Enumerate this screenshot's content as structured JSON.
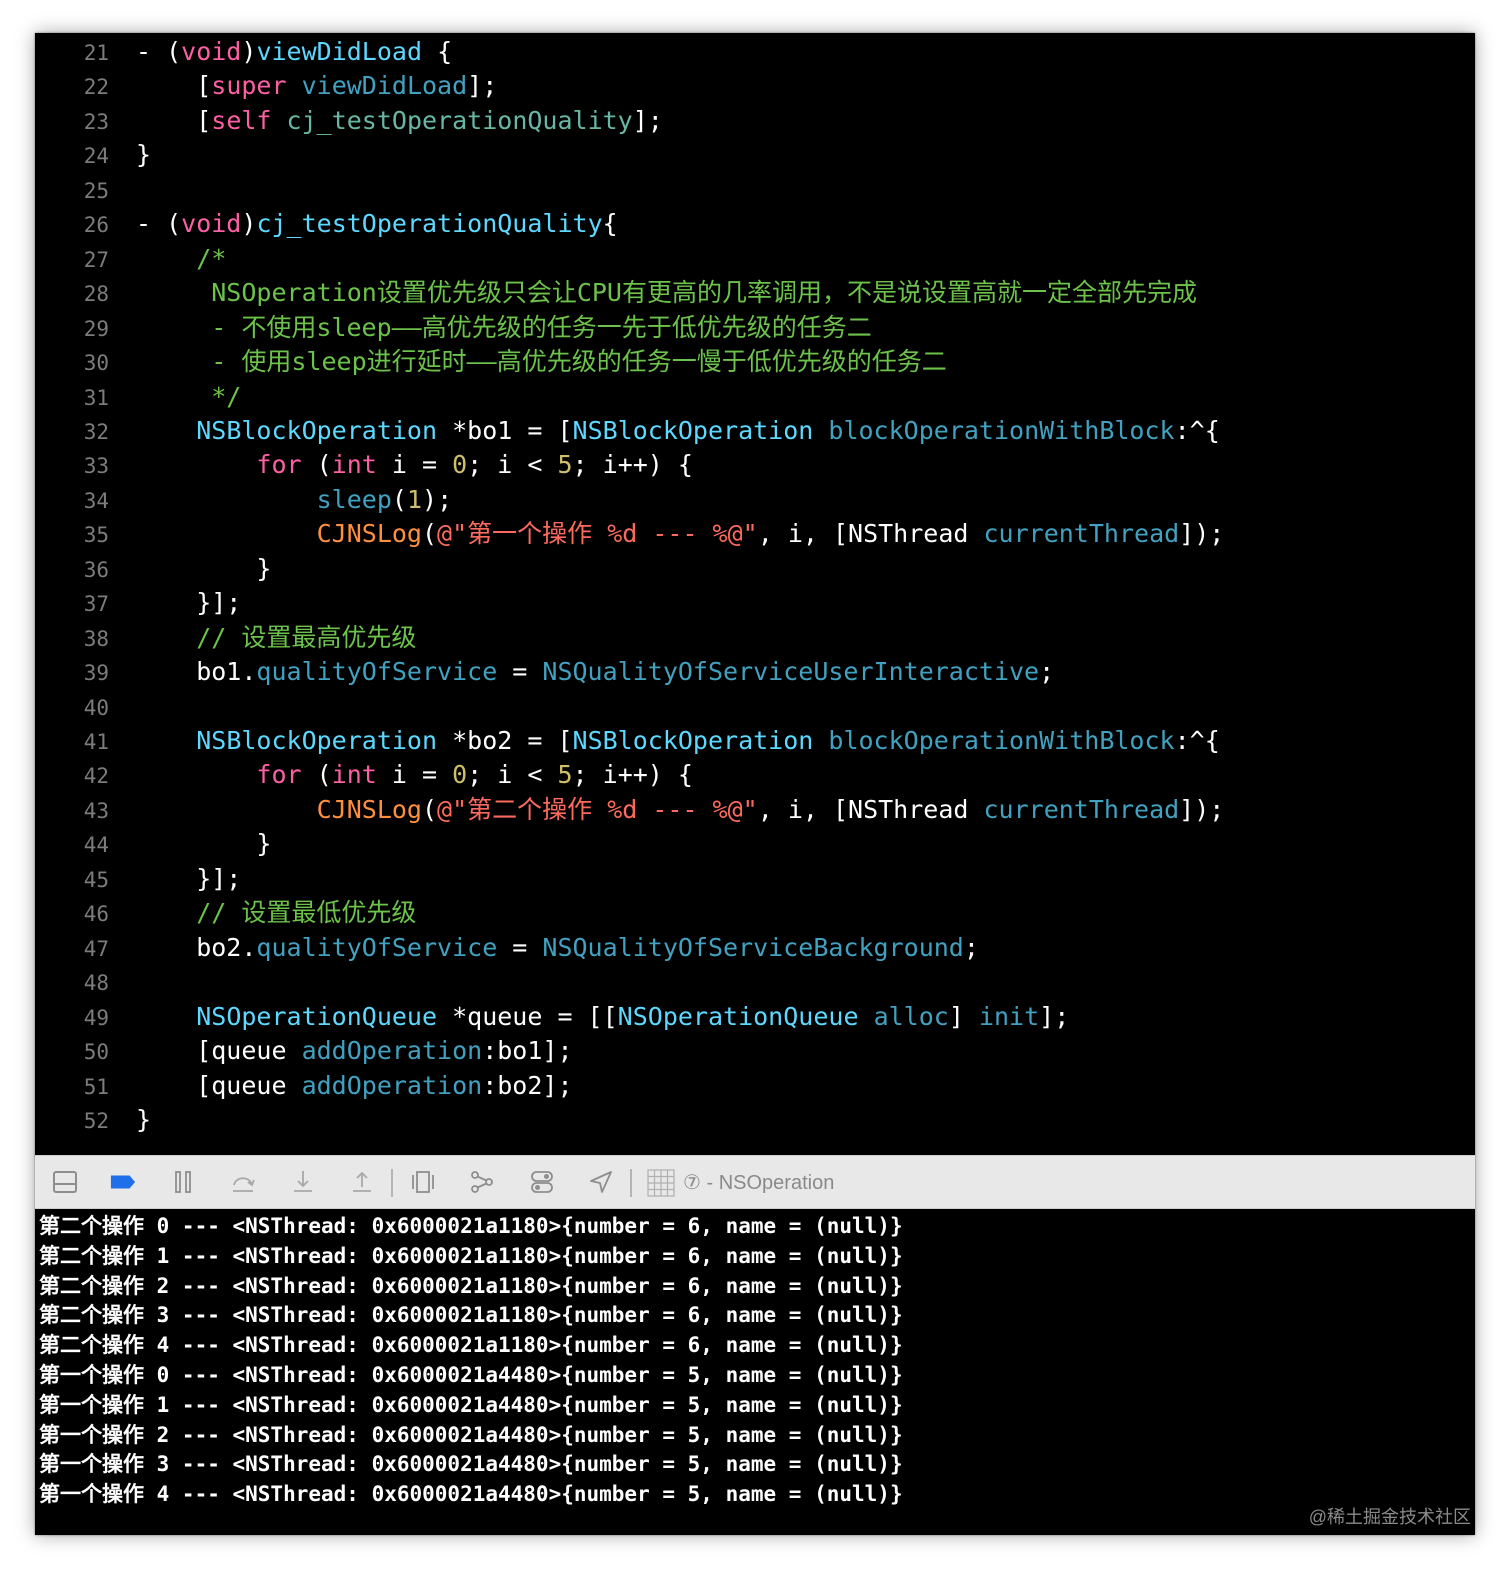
{
  "editor": {
    "lines": [
      {
        "num": "21",
        "tokens": [
          [
            "- (",
            "plain"
          ],
          [
            "void",
            "keyword"
          ],
          [
            ")",
            "plain"
          ],
          [
            "viewDidLoad",
            "decl"
          ],
          [
            " {",
            "plain"
          ]
        ]
      },
      {
        "num": "22",
        "tokens": [
          [
            "    [",
            "plain"
          ],
          [
            "super",
            "keyword"
          ],
          [
            " ",
            "plain"
          ],
          [
            "viewDidLoad",
            "api"
          ],
          [
            "];",
            "plain"
          ]
        ]
      },
      {
        "num": "23",
        "tokens": [
          [
            "    [",
            "plain"
          ],
          [
            "self",
            "keyword"
          ],
          [
            " ",
            "plain"
          ],
          [
            "cj_testOperationQuality",
            "method"
          ],
          [
            "];",
            "plain"
          ]
        ]
      },
      {
        "num": "24",
        "tokens": [
          [
            "}",
            "plain"
          ]
        ]
      },
      {
        "num": "25",
        "tokens": []
      },
      {
        "num": "26",
        "tokens": [
          [
            "- (",
            "plain"
          ],
          [
            "void",
            "keyword"
          ],
          [
            ")",
            "plain"
          ],
          [
            "cj_testOperationQuality",
            "decl"
          ],
          [
            "{",
            "plain"
          ]
        ]
      },
      {
        "num": "27",
        "tokens": [
          [
            "    /*",
            "comment"
          ]
        ]
      },
      {
        "num": "28",
        "tokens": [
          [
            "     NSOperation设置优先级只会让CPU有更高的几率调用，不是说设置高就一定全部先完成",
            "comment"
          ]
        ]
      },
      {
        "num": "29",
        "tokens": [
          [
            "     - 不使用sleep——高优先级的任务一先于低优先级的任务二",
            "comment"
          ]
        ]
      },
      {
        "num": "30",
        "tokens": [
          [
            "     - 使用sleep进行延时——高优先级的任务一慢于低优先级的任务二",
            "comment"
          ]
        ]
      },
      {
        "num": "31",
        "tokens": [
          [
            "     */",
            "comment"
          ]
        ]
      },
      {
        "num": "32",
        "tokens": [
          [
            "    ",
            "plain"
          ],
          [
            "NSBlockOperation",
            "type"
          ],
          [
            " *bo1 = [",
            "plain"
          ],
          [
            "NSBlockOperation",
            "type"
          ],
          [
            " ",
            "plain"
          ],
          [
            "blockOperationWithBlock",
            "api"
          ],
          [
            ":^{",
            "plain"
          ]
        ]
      },
      {
        "num": "33",
        "tokens": [
          [
            "        ",
            "plain"
          ],
          [
            "for",
            "keyword"
          ],
          [
            " (",
            "plain"
          ],
          [
            "int",
            "keyword"
          ],
          [
            " i = ",
            "plain"
          ],
          [
            "0",
            "number"
          ],
          [
            "; i < ",
            "plain"
          ],
          [
            "5",
            "number"
          ],
          [
            "; i++) {",
            "plain"
          ]
        ]
      },
      {
        "num": "34",
        "tokens": [
          [
            "            ",
            "plain"
          ],
          [
            "sleep",
            "api"
          ],
          [
            "(",
            "plain"
          ],
          [
            "1",
            "number"
          ],
          [
            ");",
            "plain"
          ]
        ]
      },
      {
        "num": "35",
        "tokens": [
          [
            "            ",
            "plain"
          ],
          [
            "CJNSLog",
            "macro"
          ],
          [
            "(",
            "plain"
          ],
          [
            "@\"第一个操作 %d --- %@\"",
            "string"
          ],
          [
            ", i, [NSThread ",
            "plain"
          ],
          [
            "currentThread",
            "api"
          ],
          [
            "]);",
            "plain"
          ]
        ]
      },
      {
        "num": "36",
        "tokens": [
          [
            "        }",
            "plain"
          ]
        ]
      },
      {
        "num": "37",
        "tokens": [
          [
            "    }];",
            "plain"
          ]
        ]
      },
      {
        "num": "38",
        "tokens": [
          [
            "    // 设置最高优先级",
            "comment"
          ]
        ]
      },
      {
        "num": "39",
        "tokens": [
          [
            "    bo1.",
            "plain"
          ],
          [
            "qualityOfService",
            "api"
          ],
          [
            " = ",
            "plain"
          ],
          [
            "NSQualityOfServiceUserInteractive",
            "api"
          ],
          [
            ";",
            "plain"
          ]
        ]
      },
      {
        "num": "40",
        "tokens": []
      },
      {
        "num": "41",
        "tokens": [
          [
            "    ",
            "plain"
          ],
          [
            "NSBlockOperation",
            "type"
          ],
          [
            " *bo2 = [",
            "plain"
          ],
          [
            "NSBlockOperation",
            "type"
          ],
          [
            " ",
            "plain"
          ],
          [
            "blockOperationWithBlock",
            "api"
          ],
          [
            ":^{",
            "plain"
          ]
        ]
      },
      {
        "num": "42",
        "tokens": [
          [
            "        ",
            "plain"
          ],
          [
            "for",
            "keyword"
          ],
          [
            " (",
            "plain"
          ],
          [
            "int",
            "keyword"
          ],
          [
            " i = ",
            "plain"
          ],
          [
            "0",
            "number"
          ],
          [
            "; i < ",
            "plain"
          ],
          [
            "5",
            "number"
          ],
          [
            "; i++) {",
            "plain"
          ]
        ]
      },
      {
        "num": "43",
        "tokens": [
          [
            "            ",
            "plain"
          ],
          [
            "CJNSLog",
            "macro"
          ],
          [
            "(",
            "plain"
          ],
          [
            "@\"第二个操作 %d --- %@\"",
            "string"
          ],
          [
            ", i, [NSThread ",
            "plain"
          ],
          [
            "currentThread",
            "api"
          ],
          [
            "]);",
            "plain"
          ]
        ]
      },
      {
        "num": "44",
        "tokens": [
          [
            "        }",
            "plain"
          ]
        ]
      },
      {
        "num": "45",
        "tokens": [
          [
            "    }];",
            "plain"
          ]
        ]
      },
      {
        "num": "46",
        "tokens": [
          [
            "    // 设置最低优先级",
            "comment"
          ]
        ]
      },
      {
        "num": "47",
        "tokens": [
          [
            "    bo2.",
            "plain"
          ],
          [
            "qualityOfService",
            "api"
          ],
          [
            " = ",
            "plain"
          ],
          [
            "NSQualityOfServiceBackground",
            "api"
          ],
          [
            ";",
            "plain"
          ]
        ]
      },
      {
        "num": "48",
        "tokens": []
      },
      {
        "num": "49",
        "tokens": [
          [
            "    ",
            "plain"
          ],
          [
            "NSOperationQueue",
            "type"
          ],
          [
            " *queue = [[",
            "plain"
          ],
          [
            "NSOperationQueue",
            "type"
          ],
          [
            " ",
            "plain"
          ],
          [
            "alloc",
            "api"
          ],
          [
            "] ",
            "plain"
          ],
          [
            "init",
            "api"
          ],
          [
            "];",
            "plain"
          ]
        ]
      },
      {
        "num": "50",
        "tokens": [
          [
            "    [queue ",
            "plain"
          ],
          [
            "addOperation",
            "api"
          ],
          [
            ":bo1];",
            "plain"
          ]
        ]
      },
      {
        "num": "51",
        "tokens": [
          [
            "    [queue ",
            "plain"
          ],
          [
            "addOperation",
            "api"
          ],
          [
            ":bo2];",
            "plain"
          ]
        ]
      },
      {
        "num": "52",
        "tokens": [
          [
            "}",
            "plain"
          ]
        ]
      }
    ]
  },
  "debug_bar": {
    "buttons": [
      {
        "name": "hide-debug-area-button",
        "icon": "panel-bottom-icon"
      },
      {
        "name": "toggle-breakpoints-button",
        "icon": "breakpoint-icon",
        "active": true
      },
      {
        "name": "pause-button",
        "icon": "pause-icon"
      },
      {
        "name": "step-over-button",
        "icon": "step-over-icon"
      },
      {
        "name": "step-into-button",
        "icon": "step-into-icon"
      },
      {
        "name": "step-out-button",
        "icon": "step-out-icon"
      },
      {
        "name": "debug-view-hierarchy-button",
        "icon": "view-hierarchy-icon"
      },
      {
        "name": "memory-graph-button",
        "icon": "memory-graph-icon"
      },
      {
        "name": "environment-overrides-button",
        "icon": "environment-icon"
      },
      {
        "name": "simulate-location-button",
        "icon": "location-arrow-icon"
      }
    ],
    "breadcrumb": "⑦ - NSOperation",
    "breadcrumb_icon": "thread-grid-icon",
    "accent_color": "#1f6fea"
  },
  "console": {
    "lines": [
      "第二个操作 0 --- <NSThread: 0x6000021a1180>{number = 6, name = (null)}",
      "第二个操作 1 --- <NSThread: 0x6000021a1180>{number = 6, name = (null)}",
      "第二个操作 2 --- <NSThread: 0x6000021a1180>{number = 6, name = (null)}",
      "第二个操作 3 --- <NSThread: 0x6000021a1180>{number = 6, name = (null)}",
      "第二个操作 4 --- <NSThread: 0x6000021a1180>{number = 6, name = (null)}",
      "第一个操作 0 --- <NSThread: 0x6000021a4480>{number = 5, name = (null)}",
      "第一个操作 1 --- <NSThread: 0x6000021a4480>{number = 5, name = (null)}",
      "第一个操作 2 --- <NSThread: 0x6000021a4480>{number = 5, name = (null)}",
      "第一个操作 3 --- <NSThread: 0x6000021a4480>{number = 5, name = (null)}",
      "第一个操作 4 --- <NSThread: 0x6000021a4480>{number = 5, name = (null)}"
    ]
  },
  "watermark": "@稀土掘金技术社区"
}
